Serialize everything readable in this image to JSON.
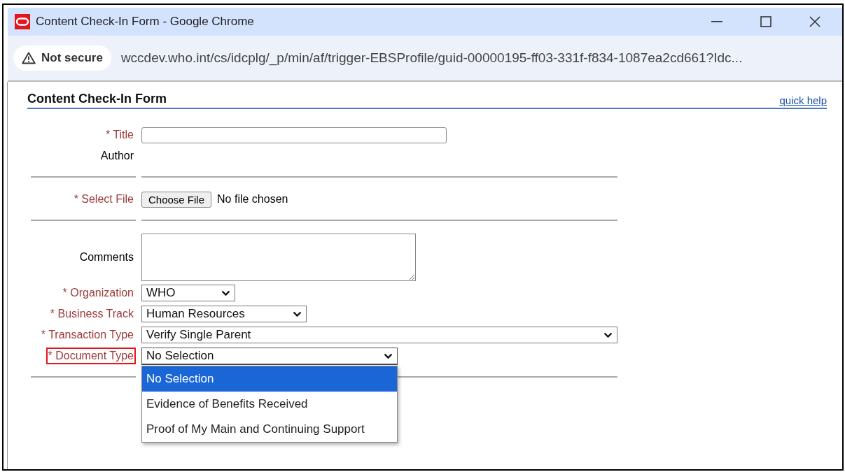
{
  "window": {
    "title": "Content Check-In Form - Google Chrome"
  },
  "address_bar": {
    "security": "Not secure",
    "url": "wccdev.who.int/cs/idcplg/_p/min/af/trigger-EBSProfile/guid-00000195-ff03-331f-f834-1087ea2cd661?Idc..."
  },
  "form": {
    "heading": "Content Check-In Form",
    "help_link": "quick help",
    "fields": [
      {
        "kind": "text",
        "label": "* Title",
        "required": true,
        "highlighted": false,
        "divider_after": false
      },
      {
        "kind": "static",
        "label": "Author",
        "required": false,
        "highlighted": false,
        "divider_after": true
      },
      {
        "kind": "file",
        "label": "* Select File",
        "required": true,
        "highlighted": false,
        "divider_after": true,
        "button": "Choose File",
        "status": "No file chosen"
      },
      {
        "kind": "textarea",
        "label": "Comments",
        "required": false,
        "highlighted": false,
        "divider_after": false
      },
      {
        "kind": "select",
        "label": "* Organization",
        "required": true,
        "highlighted": false,
        "divider_after": false,
        "value": "WHO",
        "expanded": false
      },
      {
        "kind": "select",
        "label": "* Business Track",
        "required": true,
        "highlighted": false,
        "divider_after": false,
        "value": "Human Resources",
        "expanded": false
      },
      {
        "kind": "select",
        "label": "* Transaction Type",
        "required": true,
        "highlighted": false,
        "divider_after": false,
        "value": "Verify Single Parent",
        "expanded": false
      },
      {
        "kind": "select",
        "label": "* Document Type",
        "required": true,
        "highlighted": true,
        "divider_after": true,
        "value": "No Selection",
        "expanded": true,
        "options": [
          {
            "label": "No Selection",
            "selected": true
          },
          {
            "label": "Evidence of Benefits Received",
            "selected": false
          },
          {
            "label": "Proof of My Main and Continuing Support",
            "selected": false
          }
        ]
      }
    ]
  }
}
